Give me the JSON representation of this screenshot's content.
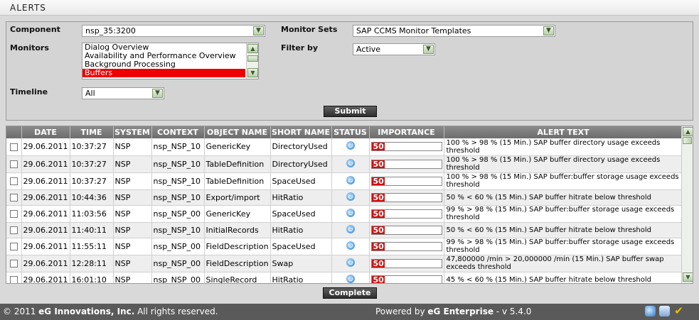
{
  "header": {
    "title": "ALERTS"
  },
  "filters": {
    "component_label": "Component",
    "component_value": "nsp_35:3200",
    "monitor_sets_label": "Monitor Sets",
    "monitor_sets_value": "SAP CCMS Monitor Templates",
    "monitors_label": "Monitors",
    "monitors_options": [
      "Dialog Overview",
      "Availability and Performance Overview",
      "Background Processing",
      "Buffers"
    ],
    "monitors_selected": "Buffers",
    "filter_by_label": "Filter by",
    "filter_by_value": "Active",
    "timeline_label": "Timeline",
    "timeline_value": "All",
    "submit_label": "Submit"
  },
  "table": {
    "columns": [
      "",
      "DATE",
      "TIME",
      "SYSTEM",
      "CONTEXT",
      "OBJECT NAME",
      "SHORT NAME",
      "STATUS",
      "IMPORTANCE",
      "ALERT TEXT"
    ],
    "rows": [
      {
        "date": "29.06.2011",
        "time": "10:37:27",
        "system": "NSP",
        "context": "nsp_NSP_10",
        "object": "GenericKey",
        "short": "DirectoryUsed",
        "importance": 50,
        "importance_label": "50",
        "text": "100 % > 98 % (15 Min.) SAP buffer directory usage exceeds threshold"
      },
      {
        "date": "29.06.2011",
        "time": "10:37:27",
        "system": "NSP",
        "context": "nsp_NSP_10",
        "object": "TableDefinition",
        "short": "DirectoryUsed",
        "importance": 50,
        "importance_label": "50",
        "text": "100 % > 98 % (15 Min.) SAP buffer directory usage exceeds threshold"
      },
      {
        "date": "29.06.2011",
        "time": "10:37:27",
        "system": "NSP",
        "context": "nsp_NSP_10",
        "object": "TableDefinition",
        "short": "SpaceUsed",
        "importance": 50,
        "importance_label": "50",
        "text": "100 % > 98 % (15 Min.) SAP buffer:buffer storage usage exceeds threshold"
      },
      {
        "date": "29.06.2011",
        "time": "10:44:36",
        "system": "NSP",
        "context": "nsp_NSP_10",
        "object": "Export/import",
        "short": "HitRatio",
        "importance": 50,
        "importance_label": "50",
        "text": "50 % < 60 % (15 Min.) SAP buffer hitrate below threshold"
      },
      {
        "date": "29.06.2011",
        "time": "11:03:56",
        "system": "NSP",
        "context": "nsp_NSP_00",
        "object": "GenericKey",
        "short": "SpaceUsed",
        "importance": 50,
        "importance_label": "50",
        "text": "99 % > 98 % (15 Min.) SAP buffer:buffer storage usage exceeds threshold"
      },
      {
        "date": "29.06.2011",
        "time": "11:40:11",
        "system": "NSP",
        "context": "nsp_NSP_10",
        "object": "InitialRecords",
        "short": "HitRatio",
        "importance": 50,
        "importance_label": "50",
        "text": "50 % < 60 % (15 Min.) SAP buffer hitrate below threshold"
      },
      {
        "date": "29.06.2011",
        "time": "11:55:11",
        "system": "NSP",
        "context": "nsp_NSP_00",
        "object": "FieldDescription",
        "short": "SpaceUsed",
        "importance": 50,
        "importance_label": "50",
        "text": "99 % > 98 % (15 Min.) SAP buffer:buffer storage usage exceeds threshold"
      },
      {
        "date": "29.06.2011",
        "time": "12:28:11",
        "system": "NSP",
        "context": "nsp_NSP_00",
        "object": "FieldDescription",
        "short": "Swap",
        "importance": 50,
        "importance_label": "50",
        "text": "47,800000 /min > 20,000000 /min (15 Min.) SAP buffer swap exceeds threshold"
      },
      {
        "date": "29.06.2011",
        "time": "16:01:10",
        "system": "NSP",
        "context": "nsp_NSP_00",
        "object": "SingleRecord",
        "short": "HitRatio",
        "importance": 50,
        "importance_label": "50",
        "text": "45 % < 60 % (15 Min.) SAP buffer hitrate below threshold"
      }
    ]
  },
  "actions": {
    "complete_label": "Complete"
  },
  "footer": {
    "copyright_prefix": "© 2011 ",
    "copyright_company": "eG Innovations, Inc.",
    "copyright_suffix": " All rights reserved.",
    "powered_prefix": "Powered by ",
    "powered_brand": "eG Enterprise",
    "version": " - v 5.4.0"
  },
  "colors": {
    "importance_fill": "#cc1111",
    "selected_option": "#ee0000",
    "footer_bg": "#5a5a5a"
  },
  "icons": {
    "status": "refresh-icon",
    "footer": [
      "refresh-icon",
      "help-icon",
      "check-icon"
    ]
  }
}
